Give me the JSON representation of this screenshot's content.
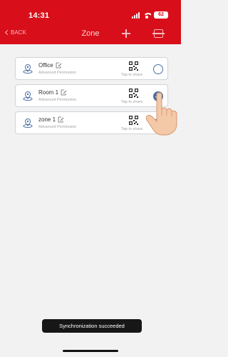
{
  "status_bar": {
    "time": "14:31",
    "battery": "62"
  },
  "nav": {
    "back_label": "BACK",
    "title": "Zone"
  },
  "zones": [
    {
      "name": "Office",
      "permission": "Advanced Permission",
      "share": "Tap to share",
      "selected": false
    },
    {
      "name": "Room 1",
      "permission": "Advanced Permission",
      "share": "Tap to share",
      "selected": true
    },
    {
      "name": "zone 1",
      "permission": "Advanced Permission",
      "share": "Tap to share",
      "selected": false
    }
  ],
  "toast": "Synchronization succeeded",
  "colors": {
    "brand": "#d80f1a",
    "accent": "#4a6fa5"
  },
  "icons": [
    "signal-icon",
    "wifi-icon",
    "battery-icon",
    "plus-icon",
    "scan-icon",
    "zone-pin-icon",
    "edit-icon",
    "qr-code-icon",
    "radio-icon",
    "hand-pointer-icon"
  ]
}
